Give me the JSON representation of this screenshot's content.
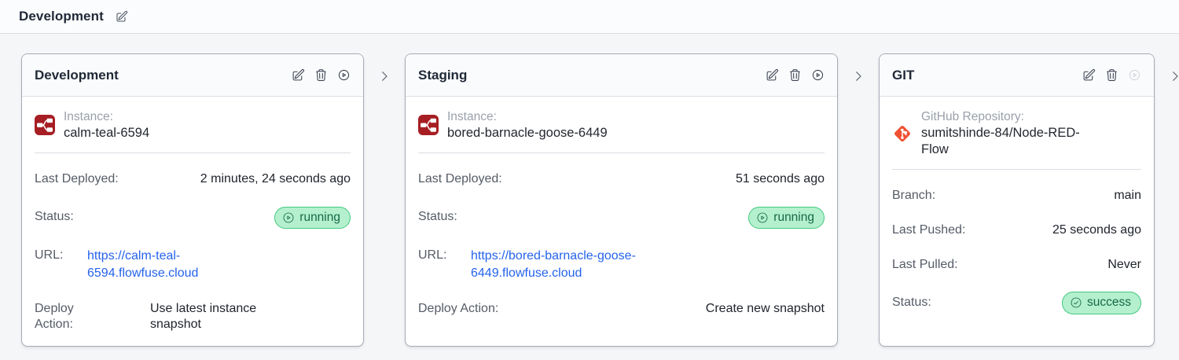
{
  "topbar": {
    "title": "Development"
  },
  "colors": {
    "link": "#2563eb",
    "pill_bg": "#b4f0cd",
    "pill_border": "#43c981",
    "pill_text": "#176849",
    "node_red": "#a61e23",
    "git_orange": "#f05133"
  },
  "stages": [
    {
      "title": "Development",
      "source": {
        "icon": "node-red-icon",
        "label": "Instance:",
        "value": "calm-teal-6594"
      },
      "rows": {
        "deployed": {
          "label": "Last Deployed:",
          "value": "2 minutes, 24 seconds ago"
        },
        "status": {
          "label": "Status:",
          "value": "running",
          "icon": "play-circle-icon"
        },
        "url": {
          "label": "URL:",
          "value": "https://calm-teal-6594.flowfuse.cloud"
        },
        "action": {
          "label": "Deploy Action:",
          "value": "Use latest instance snapshot"
        }
      }
    },
    {
      "title": "Staging",
      "source": {
        "icon": "node-red-icon",
        "label": "Instance:",
        "value": "bored-barnacle-goose-6449"
      },
      "rows": {
        "deployed": {
          "label": "Last Deployed:",
          "value": "51 seconds ago"
        },
        "status": {
          "label": "Status:",
          "value": "running",
          "icon": "play-circle-icon"
        },
        "url": {
          "label": "URL:",
          "value": "https://bored-barnacle-goose-6449.flowfuse.cloud"
        },
        "action": {
          "label": "Deploy Action:",
          "value": "Create new snapshot"
        }
      }
    },
    {
      "title": "GIT",
      "source": {
        "icon": "git-icon",
        "label": "GitHub Repository:",
        "value": "sumitshinde-84/Node-RED-Flow"
      },
      "rows": {
        "branch": {
          "label": "Branch:",
          "value": "main"
        },
        "pushed": {
          "label": "Last Pushed:",
          "value": "25 seconds ago"
        },
        "pulled": {
          "label": "Last Pulled:",
          "value": "Never"
        },
        "status": {
          "label": "Status:",
          "value": "success",
          "icon": "check-circle-icon"
        }
      }
    }
  ]
}
